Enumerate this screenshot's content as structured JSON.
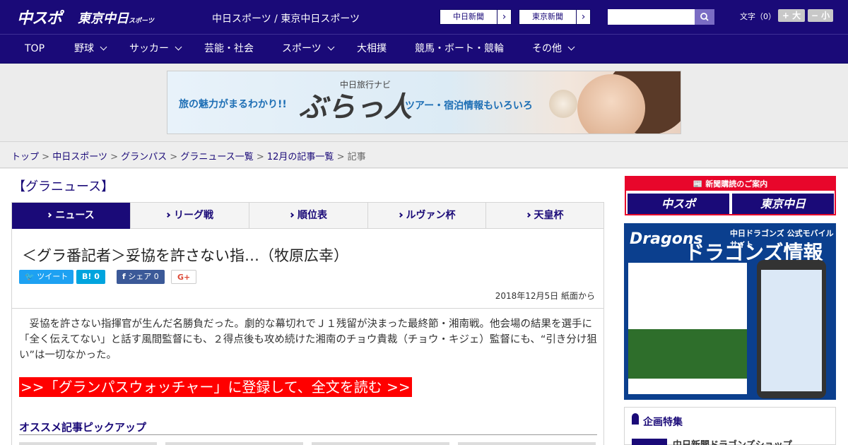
{
  "header": {
    "logo_chuspo": "中スポ",
    "logo_tokyo": "東京中日",
    "logo_tokyo_sub": "スポーツ",
    "site_title": "中日スポーツ / 東京中日スポーツ",
    "ext_links": [
      {
        "label": "中日新聞",
        "icon": "chevron-right-icon"
      },
      {
        "label": "東京新聞",
        "icon": "chevron-right-icon"
      }
    ],
    "search_placeholder": "",
    "search_icon": "search-icon",
    "font_label": "文字（0）",
    "font_plus": "+ 大",
    "font_minus": "− 小"
  },
  "nav": {
    "items": [
      {
        "label": "TOP",
        "has_menu": false
      },
      {
        "label": "野球",
        "has_menu": true
      },
      {
        "label": "サッカー",
        "has_menu": true
      },
      {
        "label": "芸能・社会",
        "has_menu": false
      },
      {
        "label": "スポーツ",
        "has_menu": true
      },
      {
        "label": "大相撲",
        "has_menu": false
      },
      {
        "label": "競馬・ボート・競輪",
        "has_menu": false
      },
      {
        "label": "その他",
        "has_menu": true
      }
    ]
  },
  "banner": {
    "left_text": "旅の魅力がまるわかり!!",
    "brand_small": "中日旅行ナビ",
    "brand_big": "ぶらっ人",
    "right_text": "ツアー・宿泊情報もいろいろ"
  },
  "breadcrumb": {
    "links": [
      "トップ",
      "中日スポーツ",
      "グランパス",
      "グラニュース一覧",
      "12月の記事一覧"
    ],
    "separator": ">",
    "current": "記事"
  },
  "section": {
    "title": "【グラニュース】"
  },
  "tabs": [
    {
      "label": "ニュース",
      "active": true
    },
    {
      "label": "リーグ戦",
      "active": false
    },
    {
      "label": "順位表",
      "active": false
    },
    {
      "label": "ルヴァン杯",
      "active": false
    },
    {
      "label": "天皇杯",
      "active": false
    }
  ],
  "article": {
    "headline": "＜グラ番記者＞妥協を許さない指…（牧原広幸）",
    "share": {
      "tweet": "ツイート",
      "hatena": "B! 0",
      "facebook": "シェア 0",
      "gplus": "G+"
    },
    "dateline": "2018年12月5日 紙面から",
    "body": "　妥協を許さない指揮官が生んだ名勝負だった。劇的な幕切れでＪ１残留が決まった最終節・湘南戦。他会場の結果を選手に「全く伝えてない」と話す風間監督にも、２得点後も攻め続けた湘南のチョウ貴裁（チョウ・キジェ）監督にも、“引き分け狙い”は一切なかった。",
    "read_more": ">>「グランパスウォッチャー」に登録して、全文を読む >>",
    "pickup_title": "オススメ記事ピックアップ"
  },
  "sidebar": {
    "subscribe_head": "新聞購読のご案内",
    "subscribe_logo_1": "中スポ",
    "subscribe_logo_2": "東京中日",
    "dragons_logo": "Dragons",
    "dragons_sub": "中日ドラゴンズ 公式モバイルサイト",
    "dragons_title": "ドラゴンズ情報",
    "feature_title": "企画特集",
    "feature_item": "中日新聞ドラゴンズショップ"
  },
  "colors": {
    "brand_navy": "#1a0a78",
    "read_more_red": "#ff0000",
    "twitter": "#1da1f2",
    "hatena": "#00a4de",
    "facebook": "#3b5998",
    "subscribe_red": "#e8062b"
  }
}
